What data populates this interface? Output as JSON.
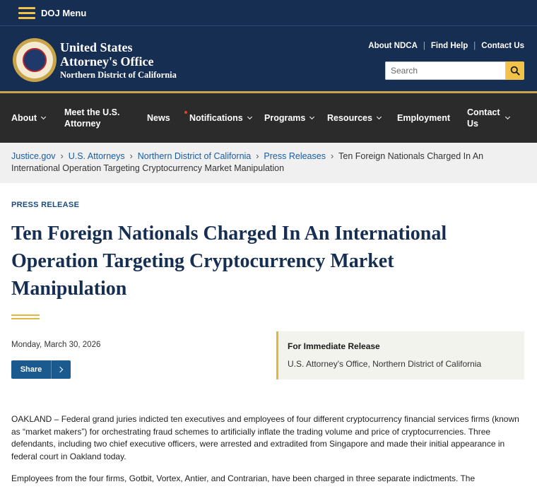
{
  "doj_bar": {
    "menu_label": "DOJ Menu"
  },
  "header": {
    "title_line1": "United States",
    "title_line2": "Attorney's Office",
    "title_line3": "Northern District of California",
    "utility_links": [
      "About NDCA",
      "Find Help",
      "Contact Us"
    ],
    "search_placeholder": "Search"
  },
  "nav": {
    "items": [
      {
        "label": "About"
      },
      {
        "label": "Meet the U.S. Attorney"
      },
      {
        "label": "News"
      },
      {
        "label": "Notifications"
      },
      {
        "label": "Programs"
      },
      {
        "label": "Resources"
      },
      {
        "label": "Employment"
      },
      {
        "label": "Contact Us"
      }
    ]
  },
  "breadcrumb": {
    "links": [
      "Justice.gov",
      "U.S. Attorneys",
      "Northern District of California",
      "Press Releases"
    ],
    "current": "Ten Foreign Nationals Charged In An International Operation Targeting Cryptocurrency Market Manipulation"
  },
  "article": {
    "eyebrow": "PRESS RELEASE",
    "title": "Ten Foreign Nationals Charged In An International Operation Targeting Cryptocurrency Market Manipulation",
    "date": "Monday, March 30, 2026",
    "share_label": "Share",
    "release_title": "For Immediate Release",
    "release_office": "U.S. Attorney's Office, Northern District of California",
    "para1": "OAKLAND – Federal grand juries indicted ten executives and employees of four different cryptocurrency financial services firms (known as “market makers”) for orchestrating fraud schemes to artificially inflate the trading volume and price of cryptocurrencies.  Three defendants, including two chief executive officers, were arrested and extradited from Singapore and made their initial appearance in federal court in Oakland today.",
    "para2": "Employees from the four firms, Gotbit, Vortex, Antier, and Contrarian, have been charged in three separate indictments.  The"
  },
  "colors": {
    "navy": "#162e51",
    "gold": "#f2c14a",
    "nav_bg": "#2b2b2b",
    "link_blue": "#1a5da5",
    "share_blue": "#1a5a8e"
  }
}
